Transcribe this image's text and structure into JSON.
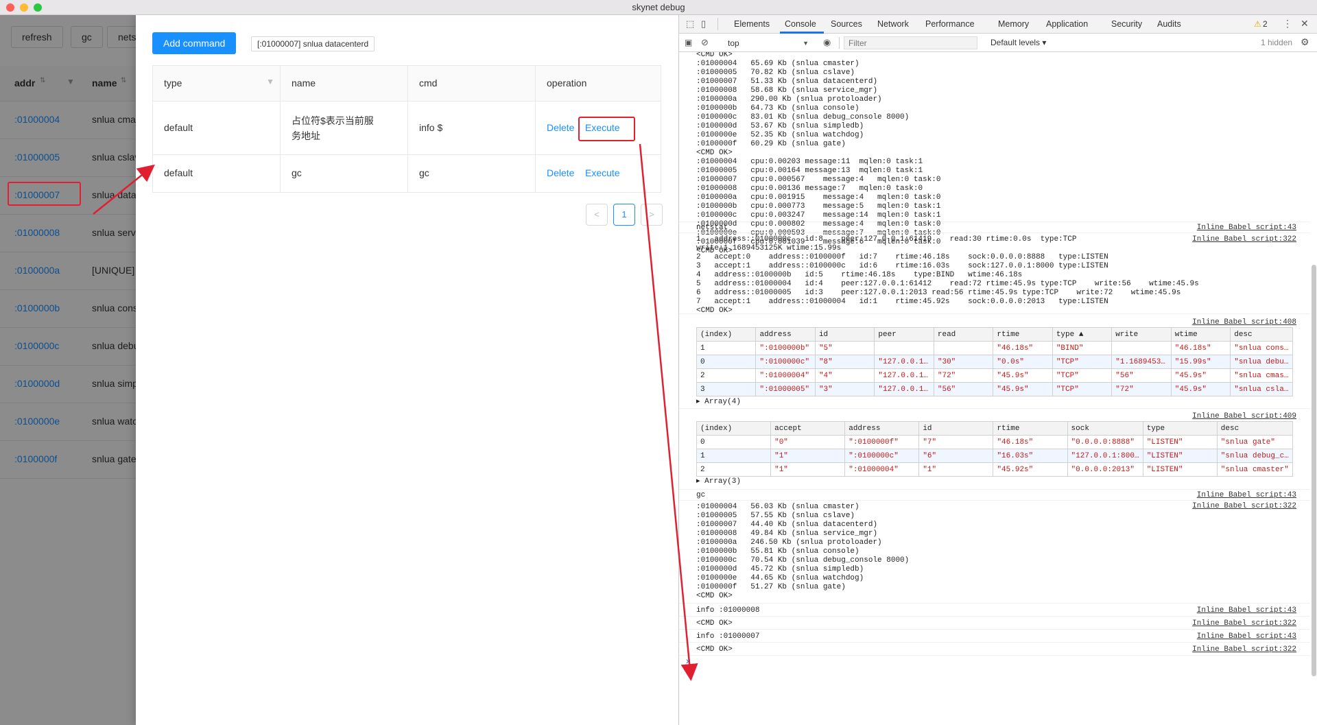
{
  "window": {
    "title": "skynet debug"
  },
  "background": {
    "buttons": [
      "refresh",
      "gc",
      "nets"
    ],
    "columns": {
      "addr": "addr",
      "name": "name"
    },
    "rows": [
      {
        "addr": ":01000004",
        "name": "snlua cmas"
      },
      {
        "addr": ":01000005",
        "name": "snlua cslav"
      },
      {
        "addr": ":01000007",
        "name": "snlua datac"
      },
      {
        "addr": ":01000008",
        "name": "snlua servi"
      },
      {
        "addr": ":0100000a",
        "name": "[UNIQUE]"
      },
      {
        "addr": ":0100000b",
        "name": "snlua cons"
      },
      {
        "addr": ":0100000c",
        "name": "snlua debu"
      },
      {
        "addr": ":0100000d",
        "name": "snlua simp"
      },
      {
        "addr": ":0100000e",
        "name": "snlua watc"
      },
      {
        "addr": ":0100000f",
        "name": "snlua gate"
      }
    ]
  },
  "drawer": {
    "add_label": "Add command",
    "tag": "[:01000007] snlua datacenterd",
    "headers": {
      "type": "type",
      "name": "name",
      "cmd": "cmd",
      "operation": "operation"
    },
    "rows": [
      {
        "type": "default",
        "name_line1": "占位符$表示当前服",
        "name_line2": "务地址",
        "cmd": "info $",
        "delete": "Delete",
        "execute": "Execute"
      },
      {
        "type": "default",
        "name_line1": "gc",
        "name_line2": "",
        "cmd": "gc",
        "delete": "Delete",
        "execute": "Execute"
      }
    ],
    "pagination": {
      "prev": "<",
      "page": "1",
      "next": ">"
    }
  },
  "devtools": {
    "tabs": [
      "Elements",
      "Console",
      "Sources",
      "Network",
      "Performance",
      "Memory",
      "Application",
      "Security",
      "Audits"
    ],
    "warnings": "2",
    "context": "top",
    "filter_placeholder": "Filter",
    "levels": "Default levels ▾",
    "hidden": "1 hidden",
    "block1": "<CMD OK>\n:01000004   65.69 Kb (snlua cmaster)\n:01000005   70.82 Kb (snlua cslave)\n:01000007   51.33 Kb (snlua datacenterd)\n:01000008   58.68 Kb (snlua service_mgr)\n:0100000a   290.00 Kb (snlua protoloader)\n:0100000b   64.73 Kb (snlua console)\n:0100000c   83.01 Kb (snlua debug_console 8000)\n:0100000d   53.67 Kb (snlua simpledb)\n:0100000e   52.35 Kb (snlua watchdog)\n:0100000f   60.29 Kb (snlua gate)\n<CMD OK>\n:01000004   cpu:0.00203 message:11  mqlen:0 task:1\n:01000005   cpu:0.00164 message:13  mqlen:0 task:1\n:01000007   cpu:0.000567    message:4   mqlen:0 task:0\n:01000008   cpu:0.00136 message:7   mqlen:0 task:0\n:0100000a   cpu:0.001915    message:4   mqlen:0 task:0\n:0100000b   cpu:0.000773    message:5   mqlen:0 task:1\n:0100000c   cpu:0.003247    message:14  mqlen:0 task:1\n:0100000d   cpu:0.000802    message:4   mqlen:0 task:0\n:0100000e   cpu:0.000593    message:7   mqlen:0 task:0\n:0100000f   cpu:0.001039    message:6   mqlen:0 task:0\n<CMD OK>",
    "netstat_label": "netstat",
    "netstat_src": "Inline Babel script:43",
    "netstat_out": "1   address::0100000c   id:8    peer:127.0.0.1:61419    read:30 rtime:0.0s  type:TCP\nwrite:1.1689453125K wtime:15.99s\n2   accept:0    address::0100000f   id:7    rtime:46.18s    sock:0.0.0.0:8888   type:LISTEN\n3   accept:1    address::0100000c   id:6    rtime:16.03s    sock:127.0.0.1:8000 type:LISTEN\n4   address::0100000b   id:5    rtime:46.18s    type:BIND   wtime:46.18s\n5   address::01000004   id:4    peer:127.0.0.1:61412    read:72 rtime:45.9s type:TCP    write:56    wtime:45.9s\n6   address::01000005   id:3    peer:127.0.0.1:2013 read:56 rtime:45.9s type:TCP    write:72    wtime:45.9s\n7   accept:1    address::01000004   id:1    rtime:45.92s    sock:0.0.0.0:2013   type:LISTEN\n<CMD OK>",
    "netstat_out_src": "Inline Babel script:322",
    "table1_src": "Inline Babel script:408",
    "table1_headers": [
      "(index)",
      "address",
      "id",
      "peer",
      "read",
      "rtime",
      "type ▲",
      "write",
      "wtime",
      "desc"
    ],
    "table1_rows": [
      [
        "1",
        "\":0100000b\"",
        "\"5\"",
        "",
        "",
        "\"46.18s\"",
        "\"BIND\"",
        "",
        "\"46.18s\"",
        "\"snlua cons…"
      ],
      [
        "0",
        "\":0100000c\"",
        "\"8\"",
        "\"127.0.0.1…",
        "\"30\"",
        "\"0.0s\"",
        "\"TCP\"",
        "\"1.1689453…",
        "\"15.99s\"",
        "\"snlua debu…"
      ],
      [
        "2",
        "\":01000004\"",
        "\"4\"",
        "\"127.0.0.1…",
        "\"72\"",
        "\"45.9s\"",
        "\"TCP\"",
        "\"56\"",
        "\"45.9s\"",
        "\"snlua cmas…"
      ],
      [
        "3",
        "\":01000005\"",
        "\"3\"",
        "\"127.0.0.1…",
        "\"56\"",
        "\"45.9s\"",
        "\"TCP\"",
        "\"72\"",
        "\"45.9s\"",
        "\"snlua csla…"
      ]
    ],
    "table1_footer": "▸ Array(4)",
    "table2_src": "Inline Babel script:409",
    "table2_headers": [
      "(index)",
      "accept",
      "address",
      "id",
      "rtime",
      "sock",
      "type",
      "desc"
    ],
    "table2_rows": [
      [
        "0",
        "\"0\"",
        "\":0100000f\"",
        "\"7\"",
        "\"46.18s\"",
        "\"0.0.0.0:8888\"",
        "\"LISTEN\"",
        "\"snlua gate\""
      ],
      [
        "1",
        "\"1\"",
        "\":0100000c\"",
        "\"6\"",
        "\"16.03s\"",
        "\"127.0.0.1:800…",
        "\"LISTEN\"",
        "\"snlua debug_c…"
      ],
      [
        "2",
        "\"1\"",
        "\":01000004\"",
        "\"1\"",
        "\"45.92s\"",
        "\"0.0.0.0:2013\"",
        "\"LISTEN\"",
        "\"snlua cmaster\""
      ]
    ],
    "table2_footer": "▸ Array(3)",
    "gc_label": "gc",
    "gc_src": "Inline Babel script:43",
    "gc_out": ":01000004   56.03 Kb (snlua cmaster)\n:01000005   57.55 Kb (snlua cslave)\n:01000007   44.40 Kb (snlua datacenterd)\n:01000008   49.84 Kb (snlua service_mgr)\n:0100000a   246.50 Kb (snlua protoloader)\n:0100000b   55.81 Kb (snlua console)\n:0100000c   70.54 Kb (snlua debug_console 8000)\n:0100000d   45.72 Kb (snlua simpledb)\n:0100000e   44.65 Kb (snlua watchdog)\n:0100000f   51.27 Kb (snlua gate)\n<CMD OK>",
    "gc_out_src": "Inline Babel script:322",
    "info8_label": "info :01000008",
    "info8_src": "Inline Babel script:43",
    "ok1": "<CMD OK>",
    "ok1_src": "Inline Babel script:322",
    "info7_label": "info :01000007",
    "info7_src": "Inline Babel script:43",
    "ok2": "<CMD OK>",
    "ok2_src": "Inline Babel script:322",
    "prompt": "›"
  }
}
